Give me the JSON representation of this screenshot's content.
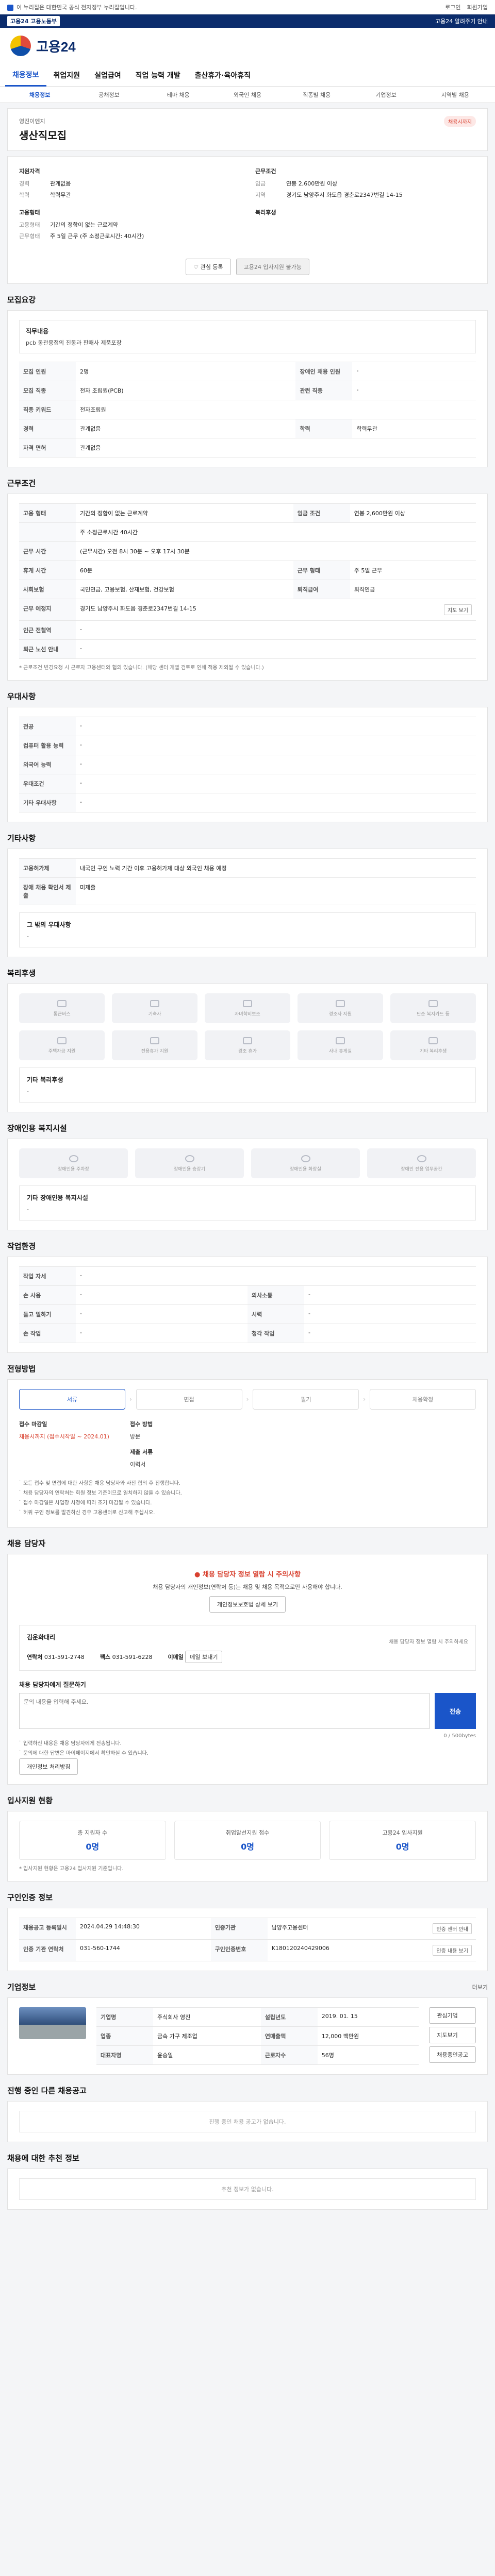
{
  "top": {
    "notice": "이 누리집은 대한민국 공식 전자정부 누리집입니다.",
    "login": "로그인",
    "join": "회원가입",
    "gov": "고용24 고용노동부",
    "gov_link": "고용24 알려주기 안내"
  },
  "logo": "고용24",
  "nav": [
    "채용정보",
    "취업지원",
    "실업급여",
    "직업 능력 개발",
    "출산휴가·육아휴직"
  ],
  "subnav": [
    "채용정보",
    "공채정보",
    "테마 채용",
    "외국인 채용",
    "직종별 채용",
    "기업정보",
    "지역별 채용"
  ],
  "head": {
    "company": "영진이엔지",
    "title": "생산직모집",
    "badge": "채용시까지"
  },
  "summary": {
    "left_title": "지원자격",
    "left": [
      {
        "k": "경력",
        "v": "관계없음"
      },
      {
        "k": "학력",
        "v": "학력무관"
      }
    ],
    "left2_title": "고용형태",
    "left2": [
      {
        "k": "고용형태",
        "v": "기간의 정함이 없는 근로계약"
      },
      {
        "k": "근무형태",
        "v": "주 5일 근무 (주 소정근로시간: 40시간)"
      }
    ],
    "right_title": "근무조건",
    "right": [
      {
        "k": "임금",
        "v": "연봉 2,600만원 이상"
      },
      {
        "k": "지역",
        "v": "경기도 남양주시 화도읍 경춘로2347번길 14-15"
      }
    ],
    "right2_title": "복리후생",
    "right2": []
  },
  "actions": {
    "bookmark": "관심 등록",
    "apply": "고용24 입사지원 불가능"
  },
  "duty": {
    "section": "모집요강",
    "box_title": "직무내용",
    "box_body": "pcb 동관용접의 진동과 판매사 제품포장",
    "rows": [
      {
        "k": "모집 인원",
        "v": "2명",
        "k2": "장애인 채용 인원",
        "v2": "-"
      },
      {
        "k": "모집 직종",
        "v": "전자 조립원(PCB)",
        "k2": "관련 직종",
        "v2": "-"
      },
      {
        "k": "직종 키워드",
        "v": "전자조립원",
        "k2": "",
        "v2": ""
      },
      {
        "k": "경력",
        "v": "관계없음",
        "k2": "학력",
        "v2": "학력무관"
      },
      {
        "k": "자격 면허",
        "v": "관계없음",
        "k2": "",
        "v2": ""
      }
    ]
  },
  "cond": {
    "section": "근무조건",
    "rows": [
      {
        "k": "고용 형태",
        "v": "기간의 정함이 없는 근로계약",
        "k2": "임금 조건",
        "v2": "연봉 2,600만원 이상"
      },
      {
        "k": "",
        "v": "주 소정근로시간 40시간",
        "k2": "",
        "v2": ""
      },
      {
        "k": "근무 시간",
        "v": "(근무시간) 오전 8시 30분 ~ 오후 17시 30분",
        "k2": "",
        "v2": ""
      },
      {
        "k": "휴게 시간",
        "v": "60분",
        "k2": "근무 형태",
        "v2": "주 5일 근무"
      },
      {
        "k": "사회보험",
        "v": "국민연금, 고용보험, 산재보험, 건강보험",
        "k2": "퇴직급여",
        "v2": "퇴직연금"
      },
      {
        "k": "근무 예정지",
        "v": "경기도 남양주시 화도읍 경춘로2347번길 14-15",
        "k2": "",
        "v2": ""
      },
      {
        "k": "인근 전철역",
        "v": "-",
        "k2": "",
        "v2": ""
      },
      {
        "k": "퇴근 노선 안내",
        "v": "-",
        "k2": "",
        "v2": ""
      }
    ],
    "map_btn": "지도 보기",
    "note": "* 근로조건 변경요청 시 근로자 고용센터와 협의 있습니다. (해당 센터 개별 검토로 인해 적용 제외될 수 있습니다.)"
  },
  "pref": {
    "section": "우대사항",
    "rows": [
      {
        "k": "전공",
        "v": "-"
      },
      {
        "k": "컴퓨터 활용 능력",
        "v": "-"
      },
      {
        "k": "외국어 능력",
        "v": "-"
      },
      {
        "k": "우대조건",
        "v": "-"
      },
      {
        "k": "기타 우대사항",
        "v": "-"
      }
    ]
  },
  "other": {
    "section": "기타사항",
    "rows": [
      {
        "k": "고용허가제",
        "v": "내국인 구인 노력 기간 이후 고용허가제 대상 외국인 채용 예정"
      },
      {
        "k": "장애 채용 확인서 제출",
        "v": "미제출"
      }
    ],
    "sub_title": "그 밖의 우대사항",
    "sub_body": "-"
  },
  "welfare": {
    "section": "복리후생",
    "icons": [
      "통근버스",
      "기숙사",
      "자녀학비보조",
      "경조사 지원",
      "단순 복지카드 등"
    ],
    "icons2": [
      "주택자금 지원",
      "전용휴가 지원",
      "경조 휴가",
      "사내 휴게실",
      "기타 복리후생"
    ],
    "sub_title": "기타 복리후생",
    "sub_body": "-"
  },
  "disability": {
    "section": "장애인용 복지시설",
    "icons": [
      "장애인용 주차장",
      "장애인용 승강기",
      "장애인용 화장실",
      "장애인 전용 업무공간"
    ],
    "sub_title": "기타 장애인용 복지시설",
    "sub_body": "-"
  },
  "env": {
    "section": "작업환경",
    "rows": [
      {
        "k": "작업 자세",
        "v": "-",
        "k2": "",
        "v2": ""
      },
      {
        "k": "손 사용",
        "v": "-",
        "k2": "의사소통",
        "v2": "-"
      },
      {
        "k": "들고 일하기",
        "v": "-",
        "k2": "시력",
        "v2": "-"
      },
      {
        "k": "손 작업",
        "v": "-",
        "k2": "청각 작업",
        "v2": "-"
      }
    ]
  },
  "process": {
    "section": "전형방법",
    "steps": [
      "서류",
      "면접",
      "필기",
      "채용확정"
    ],
    "deadline_label": "접수 마감일",
    "deadline_value": "채용시까지 (접수시작일 ~ 2024.01)",
    "method_label": "접수 방법",
    "method_value": "방문",
    "docs_label": "제출 서류",
    "docs_value": "이력서",
    "bullets": [
      "모든 접수 및 면접에 대한 사항은 채용 담당자와 사전 협의 후 진행합니다.",
      "채용 담당자의 연락처는 회원 정보 기준이므로 일치하지 않을 수 있습니다.",
      "접수 마감일은 사업장 사정에 따라 조기 마감될 수 있습니다.",
      "허위 구인 정보를 발견하신 경우 고용센터로 신고해 주십시오."
    ]
  },
  "contact": {
    "section": "채용 담당자",
    "alert": "채용 담당자 정보 열람 시 주의사항",
    "alert_body": "채용 담당자의 개인정보(연락처 등)는 채용 및 채용 목적으로만 사용해야 합니다.",
    "view_btn": "개인정보보호법 상세 보기",
    "box_title": "김운화대리",
    "box_right": "채용 담당자 정보 열람 시 주의하세요",
    "phone_label": "연락처",
    "phone": "031-591-2748",
    "fax_label": "팩스",
    "fax": "031-591-6228",
    "email_label": "이메일",
    "email_btn": "메일 보내기"
  },
  "feedback": {
    "title": "채용 담당자에게 질문하기",
    "placeholder": "문의 내용을 입력해 주세요.",
    "count": "0 / 500bytes",
    "send": "전송",
    "bullets": [
      "입력하신 내용은 채용 담당자에게 전송됩니다.",
      "문의에 대한 답변은 마이페이지에서 확인하실 수 있습니다."
    ],
    "policy_btn": "개인정보 처리방침"
  },
  "applicants": {
    "section": "입사지원 현황",
    "stats": [
      {
        "label": "총 지원자 수",
        "value": "0명"
      },
      {
        "label": "취업알선지원 접수",
        "value": "0명"
      },
      {
        "label": "고용24 입사지원",
        "value": "0명"
      }
    ],
    "note": "* 입사지원 현황은 고용24 입사지원 기준입니다."
  },
  "managing": {
    "section": "구인인증 정보",
    "rows": [
      {
        "k": "채용공고 등록일시",
        "v": "2024.04.29 14:48:30",
        "k2": "인증기관",
        "v2": "남양주고용센터"
      },
      {
        "k": "인증 기관 연락처",
        "v": "031-560-1744",
        "k2": "구인인증번호",
        "v2": "K180120240429006"
      }
    ],
    "btn": "인증 센터 안내",
    "btn2": "인증 내용 보기"
  },
  "company": {
    "section": "기업정보",
    "more": "더보기",
    "rows": [
      {
        "k": "기업명",
        "v": "주식회사 영진",
        "k2": "설립년도",
        "v2": "2019. 01. 15"
      },
      {
        "k": "업종",
        "v": "금속 가구 제조업",
        "k2": "연매출액",
        "v2": "12,000 백만원"
      },
      {
        "k": "대표자명",
        "v": "윤승일",
        "k2": "근로자수",
        "v2": "56명"
      }
    ],
    "bookmark": "관심기업",
    "map": "지도보기",
    "other": "채용중인공고"
  },
  "closing": {
    "title1": "진행 중인 다른 채용공고",
    "empty1": "진행 중인 채용 공고가 없습니다.",
    "title2": "채용에 대한 추천 정보",
    "empty2": "추천 정보가 없습니다."
  }
}
